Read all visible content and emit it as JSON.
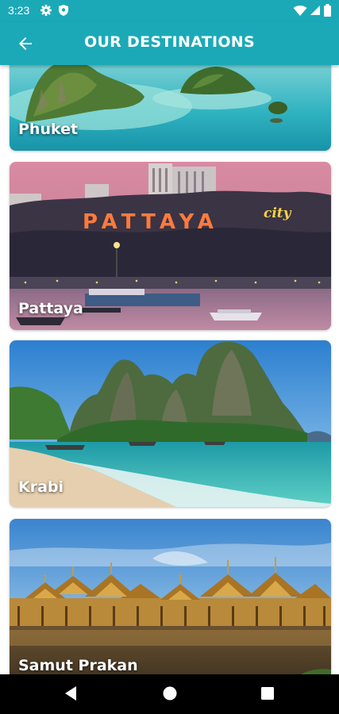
{
  "status_bar": {
    "time": "3:23"
  },
  "app_bar": {
    "title": "OUR DESTINATIONS"
  },
  "destinations": [
    {
      "name": "Phuket"
    },
    {
      "name": "Pattaya",
      "sign_text": "PATTAYA",
      "sign_suffix": "city"
    },
    {
      "name": "Krabi"
    },
    {
      "name": "Samut Prakan"
    }
  ],
  "colors": {
    "app_bar": "#1ba9b8",
    "nav_bar": "#000000"
  },
  "icons": {
    "status": [
      "gear-icon",
      "shield-icon",
      "wifi-icon",
      "signal-icon",
      "battery-icon"
    ],
    "app_bar": "back-arrow-icon",
    "nav": [
      "back-triangle-icon",
      "home-circle-icon",
      "recents-square-icon"
    ]
  }
}
